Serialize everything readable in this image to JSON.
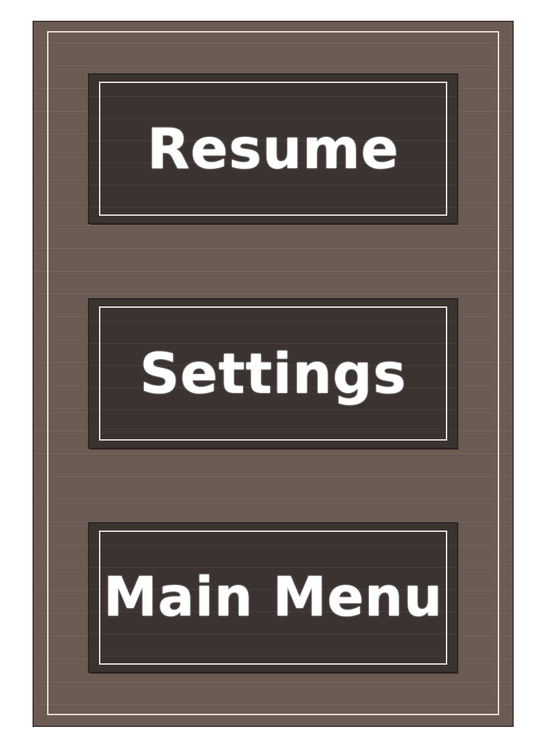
{
  "pause_menu": {
    "buttons": [
      {
        "id": "resume",
        "label": "Resume"
      },
      {
        "id": "settings",
        "label": "Settings"
      },
      {
        "id": "main_menu",
        "label": "Main Menu"
      }
    ]
  },
  "colors": {
    "panel_bg": "#6b5b53",
    "button_bg": "#3a3330",
    "frame_line": "#e9e2dd",
    "label_text": "#ffffff"
  }
}
